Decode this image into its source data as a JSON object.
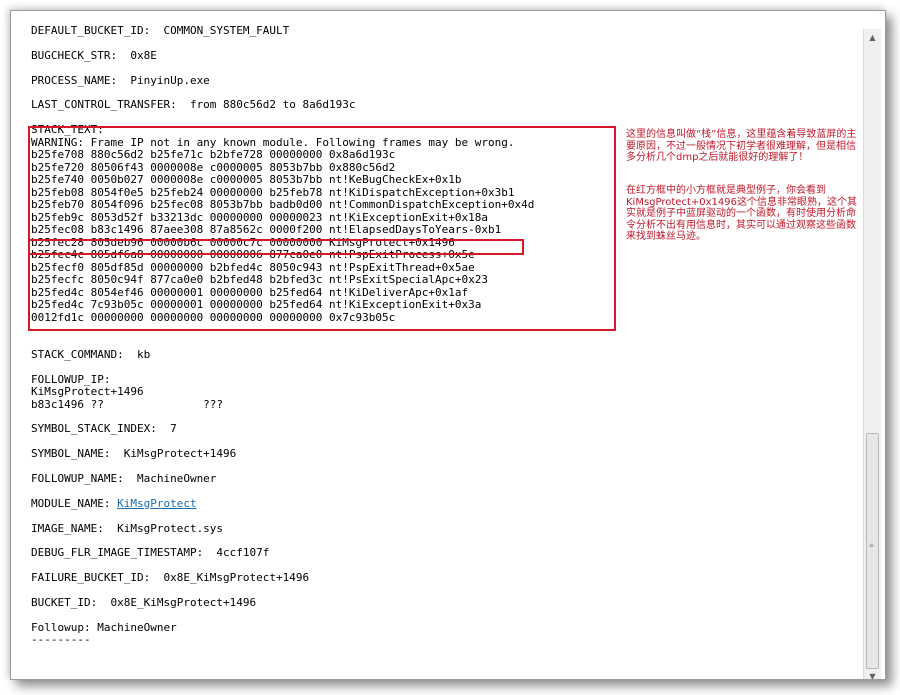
{
  "dump": {
    "header_lines": [
      "DEFAULT_BUCKET_ID:  COMMON_SYSTEM_FAULT",
      "BUGCHECK_STR:  0x8E",
      "PROCESS_NAME:  PinyinUp.exe",
      "LAST_CONTROL_TRANSFER:  from 880c56d2 to 8a6d193c"
    ],
    "stack_text_label": "STACK_TEXT:",
    "stack_warning": "WARNING: Frame IP not in any known module. Following frames may be wrong.",
    "stack_rows": [
      "b25fe708 880c56d2 b25fe71c b2bfe728 00000000 0x8a6d193c",
      "b25fe720 80506f43 0000008e c0000005 8053b7bb 0x880c56d2",
      "b25fe740 0050b027 0000008e c0000005 8053b7bb nt!KeBugCheckEx+0x1b",
      "b25feb08 8054f0e5 b25feb24 00000000 b25feb78 nt!KiDispatchException+0x3b1",
      "b25feb70 8054f096 b25fec08 8053b7bb badb0d00 nt!CommonDispatchException+0x4d",
      "b25feb9c 8053d52f b33213dc 00000000 00000023 nt!KiExceptionExit+0x18a",
      "b25fec08 b83c1496 87aee308 87a8562c 0000f200 nt!ElapsedDaysToYears-0xb1",
      "b25fec28 805deb96 00000b6c 00000c7c 00000000 KiMsgProtect+0x1496",
      "b25fec4c 805df6a8 00000000 00000006 877ca0e0 nt!PspExitProcess+0x5e",
      "b25fecf0 805df85d 00000000 b2bfed4c 8050c943 nt!PspExitThread+0x5ae",
      "b25fecfc 8050c94f 877ca0e0 b2bfed48 b2bfed3c nt!PsExitSpecialApc+0x23",
      "b25fed4c 8054ef46 00000001 00000000 b25fed64 nt!KiDeliverApc+0x1af",
      "b25fed4c 7c93b05c 00000001 00000000 b25fed64 nt!KiExceptionExit+0x3a",
      "0012fd1c 00000000 00000000 00000000 00000000 0x7c93b05c"
    ],
    "stack_command": "STACK_COMMAND:  kb",
    "followup_ip_label": "FOLLOWUP_IP:",
    "followup_ip_lines": [
      "KiMsgProtect+1496",
      "b83c1496 ??               ???"
    ],
    "symbol_stack_index": "SYMBOL_STACK_INDEX:  7",
    "symbol_name": "SYMBOL_NAME:  KiMsgProtect+1496",
    "followup_name": "FOLLOWUP_NAME:  MachineOwner",
    "module_name_label": "MODULE_NAME: ",
    "module_name_link": "KiMsgProtect",
    "image_name": "IMAGE_NAME:  KiMsgProtect.sys",
    "debug_timestamp": "DEBUG_FLR_IMAGE_TIMESTAMP:  4ccf107f",
    "failure_bucket": "FAILURE_BUCKET_ID:  0x8E_KiMsgProtect+1496",
    "bucket_id": "BUCKET_ID:  0x8E_KiMsgProtect+1496",
    "followup": "Followup: MachineOwner",
    "separator": "---------"
  },
  "annotations": {
    "note1": "这里的信息叫做“栈”信息，这里蕴含着导致蓝屏的主要原因，不过一般情况下初学者很难理解，但是相信多分析几个dmp之后就能很好的理解了！",
    "note2": "在红方框中的小方框就是典型例子，你会看到KiMsgProtect+0x1496这个信息非常眼熟，这个其实就是例子中蓝屏驱动的一个函数，有时使用分析命令分析不出有用信息时，其实可以通过观察这些函数来找到蛛丝马迹。"
  },
  "colors": {
    "highlight_box": "#d8172a",
    "annotation_text": "#c0182a",
    "link": "#1c6aa8"
  },
  "scrollbar": {
    "up_icon": "▲",
    "down_icon": "▼",
    "grip_icon": "≡",
    "position_fraction": 0.6
  }
}
